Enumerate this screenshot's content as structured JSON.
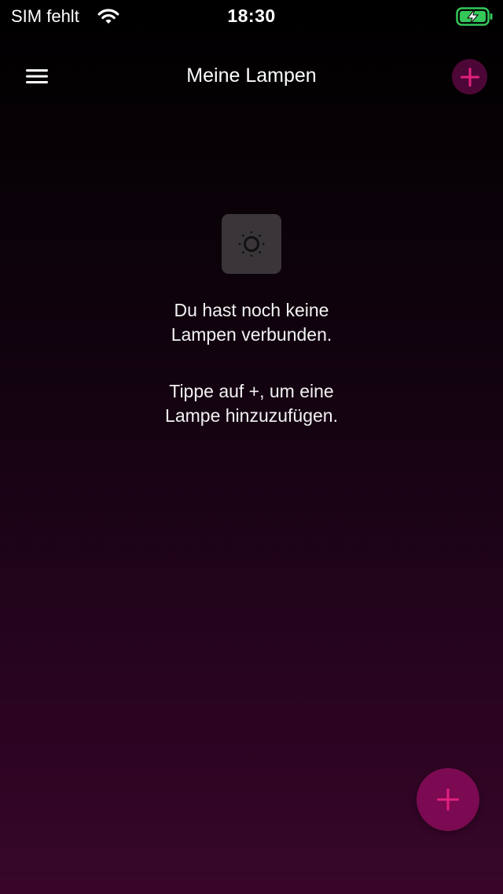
{
  "status_bar": {
    "carrier": "SIM fehlt",
    "time": "18:30",
    "wifi_icon": "wifi-icon",
    "battery_icon": "battery-charging-icon",
    "battery_color": "#34c759"
  },
  "nav": {
    "title": "Meine Lampen",
    "menu_icon": "hamburger-menu-icon",
    "add_icon": "plus-icon"
  },
  "empty_state": {
    "icon": "lamp-brightness-icon",
    "line1": "Du hast noch keine\nLampen verbunden.",
    "line2": "Tippe auf +, um eine\nLampe hinzuzufügen."
  },
  "fab": {
    "icon": "plus-icon"
  },
  "colors": {
    "accent": "#e4207f",
    "fab_background": "#7b0a52",
    "nav_add_background": "#4d0736"
  }
}
